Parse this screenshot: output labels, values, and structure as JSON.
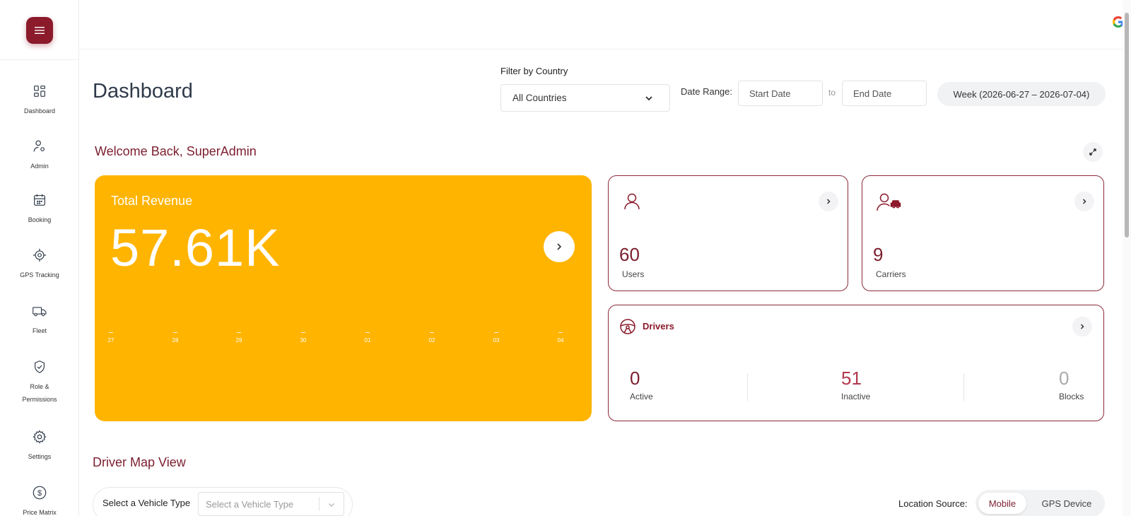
{
  "sidebar": {
    "items": [
      {
        "label": "Dashboard",
        "icon": "dashboard-icon"
      },
      {
        "label": "Admin",
        "icon": "admin-icon"
      },
      {
        "label": "Booking",
        "icon": "calendar-icon"
      },
      {
        "label": "GPS Tracking",
        "icon": "gps-icon"
      },
      {
        "label": "Fleet",
        "icon": "truck-icon"
      },
      {
        "label": "Role &",
        "label2": "Permissions",
        "icon": "shield-icon"
      },
      {
        "label": "Settings",
        "icon": "gear-icon"
      },
      {
        "label": "Price Matrix",
        "icon": "dollar-icon"
      }
    ]
  },
  "topbar": {
    "google": "G",
    "icons": [
      "google-icon",
      "bell-icon",
      "avatar-icon"
    ]
  },
  "header": {
    "title": "Dashboard",
    "filter_label": "Filter by Country",
    "country_value": "All Countries",
    "date_range_label": "Date Range:",
    "start_placeholder": "Start Date",
    "to": "to",
    "end_placeholder": "End Date",
    "week_range": "Week (2026-06-27 – 2026-07-04)"
  },
  "welcome": "Welcome Back, SuperAdmin",
  "revenue": {
    "title": "Total Revenue",
    "value": "57.61K",
    "ticks": [
      "27",
      "28",
      "29",
      "30",
      "01",
      "02",
      "03",
      "04"
    ]
  },
  "users": {
    "value": "60",
    "label": "Users"
  },
  "carriers": {
    "value": "9",
    "label": "Carriers"
  },
  "drivers": {
    "title": "Drivers",
    "active": {
      "value": "0",
      "label": "Active"
    },
    "inactive": {
      "value": "51",
      "label": "Inactive"
    },
    "blocks": {
      "value": "0",
      "label": "Blocks"
    }
  },
  "map": {
    "title": "Driver Map View",
    "vehicle_label": "Select a Vehicle Type",
    "vehicle_placeholder": "Select a Vehicle Type",
    "location_label": "Location Source:",
    "options": [
      "Mobile",
      "GPS Device"
    ],
    "selected": "Mobile"
  },
  "colors": {
    "brand": "#8b1a2b",
    "accent": "#ffb400",
    "heading": "#7c1f2e"
  }
}
